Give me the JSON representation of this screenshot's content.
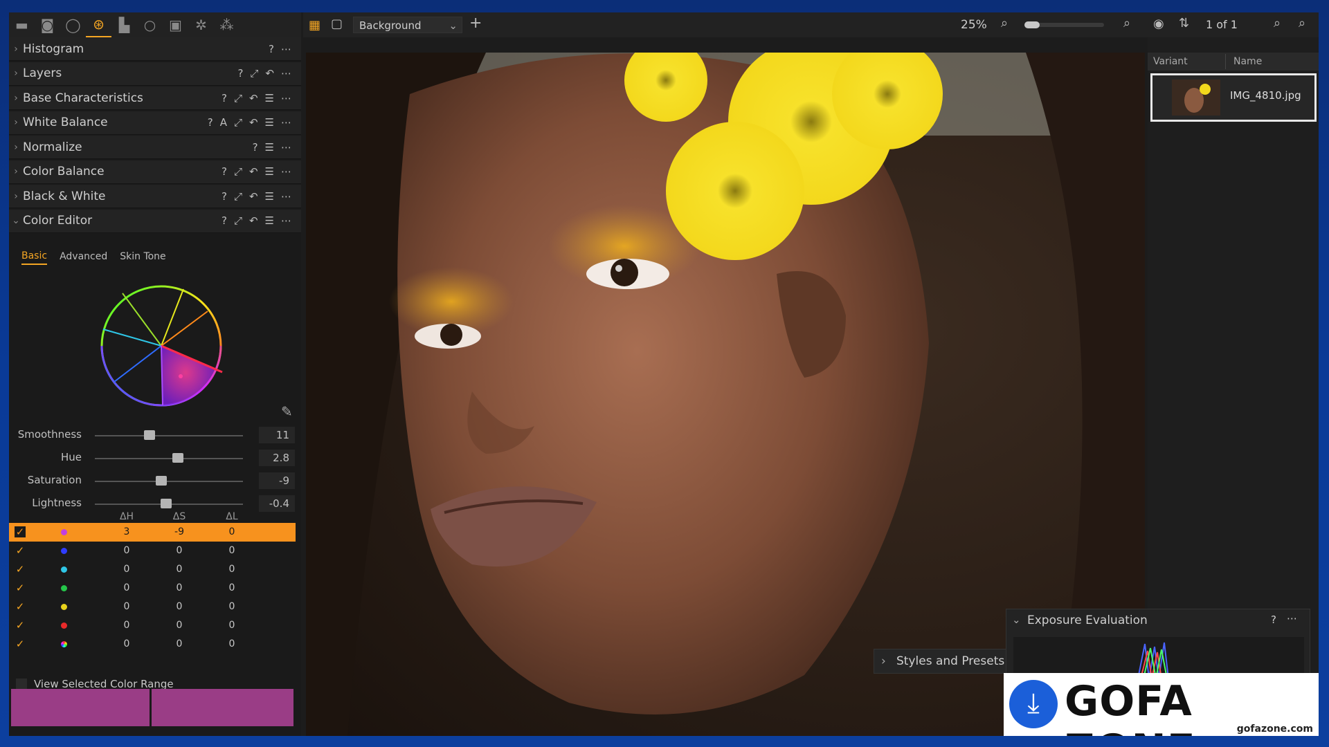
{
  "left_panel": {
    "tool_tabs": [
      "folder-icon",
      "camera-icon",
      "circle-icon",
      "color-icon",
      "exposure-icon",
      "search-detail-icon",
      "clipboard-icon",
      "gear-icon",
      "adjustments-icon"
    ],
    "sections": [
      {
        "title": "Histogram",
        "icons": [
          "?",
          "⋯"
        ]
      },
      {
        "title": "Layers",
        "icons": [
          "?",
          "⤢",
          "↶",
          "⋯"
        ]
      },
      {
        "title": "Base Characteristics",
        "icons": [
          "?",
          "⤢",
          "↶",
          "☰",
          "⋯"
        ]
      },
      {
        "title": "White Balance",
        "icons": [
          "?",
          "A",
          "⤢",
          "↶",
          "☰",
          "⋯"
        ]
      },
      {
        "title": "Normalize",
        "icons": [
          "?",
          "☰",
          "⋯"
        ]
      },
      {
        "title": "Color Balance",
        "icons": [
          "?",
          "⤢",
          "↶",
          "☰",
          "⋯"
        ]
      },
      {
        "title": "Black & White",
        "icons": [
          "?",
          "⤢",
          "↶",
          "☰",
          "⋯"
        ]
      },
      {
        "title": "Color Editor",
        "icons": [
          "?",
          "⤢",
          "↶",
          "☰",
          "⋯"
        ],
        "expanded": true
      }
    ],
    "color_editor": {
      "tabs": [
        "Basic",
        "Advanced",
        "Skin Tone"
      ],
      "active_tab": "Basic",
      "sliders": [
        {
          "label": "Smoothness",
          "value": "11",
          "fraction": 0.37
        },
        {
          "label": "Hue",
          "value": "2.8",
          "fraction": 0.56
        },
        {
          "label": "Saturation",
          "value": "-9",
          "fraction": 0.45
        },
        {
          "label": "Lightness",
          "value": "-0.4",
          "fraction": 0.48
        }
      ],
      "table_headers": [
        "ΔH",
        "ΔS",
        "ΔL"
      ],
      "rows": [
        {
          "checked": true,
          "color": "#c23fe0",
          "dh": "3",
          "ds": "-9",
          "dl": "0",
          "selected": true
        },
        {
          "checked": true,
          "color": "#2f3cff",
          "dh": "0",
          "ds": "0",
          "dl": "0"
        },
        {
          "checked": true,
          "color": "#2fc6e6",
          "dh": "0",
          "ds": "0",
          "dl": "0"
        },
        {
          "checked": true,
          "color": "#25c64a",
          "dh": "0",
          "ds": "0",
          "dl": "0"
        },
        {
          "checked": true,
          "color": "#e8d21c",
          "dh": "0",
          "ds": "0",
          "dl": "0"
        },
        {
          "checked": true,
          "color": "#e82a2a",
          "dh": "0",
          "ds": "0",
          "dl": "0"
        },
        {
          "checked": true,
          "color": "multi",
          "dh": "0",
          "ds": "0",
          "dl": "0"
        }
      ],
      "view_selected_label": "View Selected Color Range",
      "swatch_color": "#9a3d86"
    }
  },
  "top_bar": {
    "layer_select": "Background",
    "zoom": "25%",
    "zoom_fraction": 0.1,
    "counter": "1 of 1"
  },
  "right_panel": {
    "columns": [
      "Variant",
      "Name"
    ],
    "items": [
      {
        "name": "IMG_4810.jpg"
      }
    ]
  },
  "floating": {
    "styles_presets": "Styles and Presets",
    "exposure_eval": "Exposure Evaluation"
  },
  "watermark": {
    "brand": "GOFA ZONE",
    "url": "gofazone.com"
  }
}
